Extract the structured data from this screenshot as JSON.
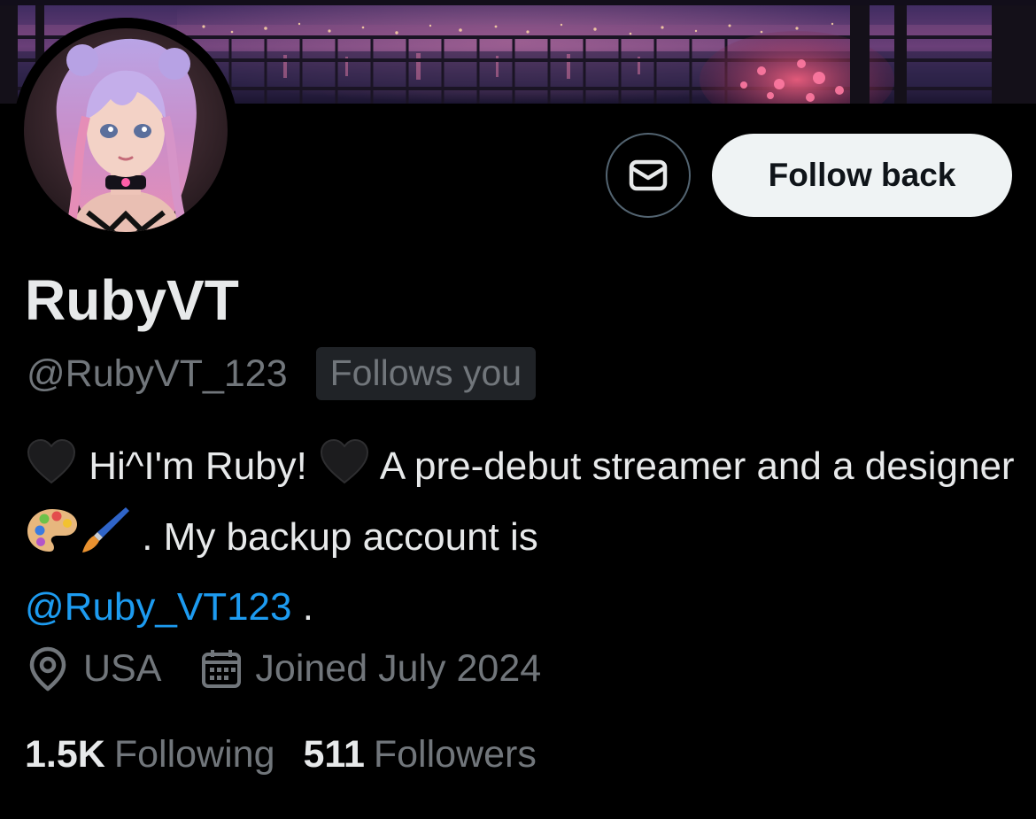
{
  "profile": {
    "display_name": "RubyVT",
    "handle": "@RubyVT_123",
    "follows_you_label": "Follows you",
    "bio": {
      "part1": "Hi^I'm Ruby!",
      "part2": "A pre-debut streamer and a designer",
      "part3": ". My backup account is",
      "mention": "@Ruby_VT123",
      "part4": "."
    },
    "location": "USA",
    "joined": "Joined July 2024",
    "following_count": "1.5K",
    "following_label": "Following",
    "followers_count": "511",
    "followers_label": "Followers"
  },
  "actions": {
    "follow_back_label": "Follow back"
  },
  "icons": {
    "message": "envelope-icon",
    "location": "location-pin-icon",
    "joined": "calendar-icon",
    "bio_heart": "black-heart-emoji",
    "bio_palette": "artist-palette-emoji",
    "bio_brush": "paintbrush-emoji"
  },
  "colors": {
    "background": "#000000",
    "primary_text": "#e7e9ea",
    "secondary_text": "#71767b",
    "link": "#1d9bf0",
    "follow_button_bg": "#eff3f4",
    "follow_button_text": "#0f1419",
    "badge_bg": "#202327"
  }
}
